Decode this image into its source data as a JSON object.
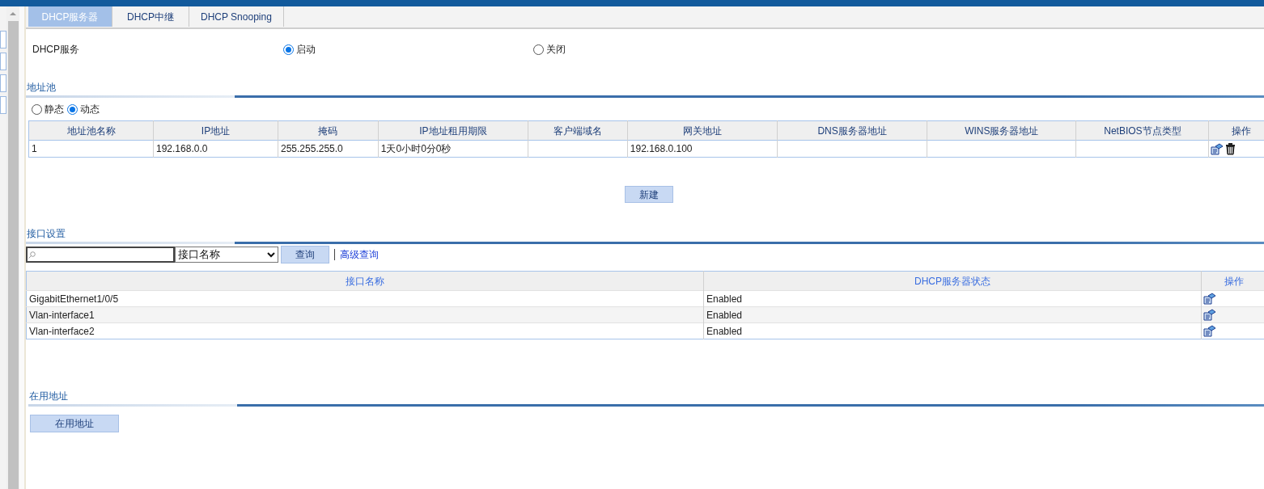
{
  "tabs": [
    {
      "label": "DHCP服务器",
      "selected": true
    },
    {
      "label": "DHCP中继",
      "selected": false
    },
    {
      "label": "DHCP Snooping",
      "selected": false
    }
  ],
  "dhcp_service": {
    "label": "DHCP服务",
    "options": [
      {
        "label": "启动",
        "selected": true
      },
      {
        "label": "关闭",
        "selected": false
      }
    ]
  },
  "address_pool": {
    "title": "地址池",
    "mode_options": [
      {
        "label": "静态",
        "selected": false
      },
      {
        "label": "动态",
        "selected": true
      }
    ],
    "table": {
      "columns": [
        "地址池名称",
        "IP地址",
        "掩码",
        "IP地址租用期限",
        "客户端域名",
        "网关地址",
        "DNS服务器地址",
        "WINS服务器地址",
        "NetBIOS节点类型",
        "操作"
      ],
      "rows": [
        {
          "cells": [
            "1",
            "192.168.0.0",
            "255.255.255.0",
            "1天0小时0分0秒",
            "",
            "192.168.0.100",
            "",
            "",
            ""
          ]
        }
      ]
    },
    "new_button": "新建"
  },
  "interface_settings": {
    "title": "接口设置",
    "filter": "接口名称",
    "query_button": "查询",
    "advanced_link": "高级查询",
    "table": {
      "columns": [
        "接口名称",
        "DHCP服务器状态",
        "操作"
      ],
      "rows": [
        {
          "cells": [
            "GigabitEthernet1/0/5",
            "Enabled"
          ]
        },
        {
          "cells": [
            "Vlan-interface1",
            "Enabled"
          ]
        },
        {
          "cells": [
            "Vlan-interface2",
            "Enabled"
          ]
        }
      ]
    }
  },
  "in_use": {
    "title": "在用地址",
    "button": "在用地址"
  }
}
